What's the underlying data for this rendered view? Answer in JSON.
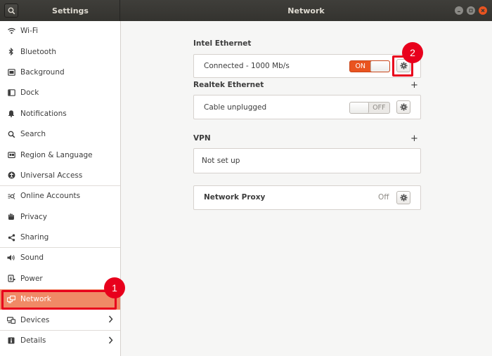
{
  "window": {
    "sidebar_title": "Settings",
    "panel_title": "Network",
    "controls": [
      "minimize-icon",
      "maximize-icon",
      "close-icon"
    ]
  },
  "sidebar": {
    "items": [
      {
        "label": "Wi-Fi",
        "icon": "wifi-icon"
      },
      {
        "label": "Bluetooth",
        "icon": "bluetooth-icon"
      },
      {
        "label": "Background",
        "icon": "background-icon"
      },
      {
        "label": "Dock",
        "icon": "dock-icon"
      },
      {
        "label": "Notifications",
        "icon": "bell-icon"
      },
      {
        "label": "Search",
        "icon": "search-icon"
      },
      {
        "label": "Region & Language",
        "icon": "region-icon"
      },
      {
        "label": "Universal Access",
        "icon": "accessibility-icon"
      },
      {
        "label": "Online Accounts",
        "icon": "online-accounts-icon"
      },
      {
        "label": "Privacy",
        "icon": "hand-icon"
      },
      {
        "label": "Sharing",
        "icon": "share-icon"
      },
      {
        "label": "Sound",
        "icon": "speaker-icon"
      },
      {
        "label": "Power",
        "icon": "power-icon"
      },
      {
        "label": "Network",
        "icon": "network-icon",
        "selected": true
      },
      {
        "label": "Devices",
        "icon": "devices-icon",
        "has_submenu": true
      },
      {
        "label": "Details",
        "icon": "details-icon",
        "has_submenu": true
      }
    ]
  },
  "main": {
    "intel": {
      "title": "Intel Ethernet",
      "status": "Connected - 1000 Mb/s",
      "toggle_label": "ON",
      "toggle_state": "on"
    },
    "realtek": {
      "title": "Realtek Ethernet",
      "add_label": "+",
      "status": "Cable unplugged",
      "toggle_label": "OFF",
      "toggle_state": "off"
    },
    "vpn": {
      "title": "VPN",
      "add_label": "+",
      "status": "Not set up"
    },
    "proxy": {
      "title": "Network Proxy",
      "value": "Off"
    }
  },
  "callouts": {
    "one": "1",
    "two": "2",
    "color": "#e8001c"
  },
  "colors": {
    "accent": "#e95420",
    "selected_row": "#f08a66",
    "headerbar": "#3a3935"
  }
}
